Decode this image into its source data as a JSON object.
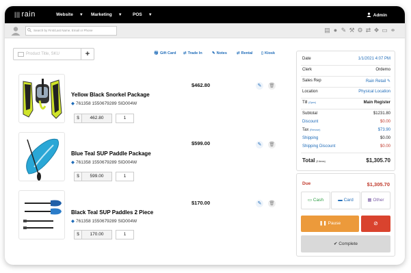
{
  "topbar": {
    "logo": "rain",
    "nav": [
      "Website",
      "Marketing",
      "POS"
    ],
    "user": "Admin"
  },
  "search": {
    "placeholder": "Search by First/Last Name, Email or Phone"
  },
  "toolbar_icons": [
    "document-icon",
    "chat-icon",
    "edit-icon",
    "wrench-icon",
    "gear-icon",
    "exchange-icon",
    "dropbox-icon",
    "card-icon",
    "handshake-icon"
  ],
  "product_search": {
    "placeholder": "Product Title, SKU"
  },
  "actions": {
    "gift_card": "Gift Card",
    "trade_in": "Trade In",
    "notes": "Notes",
    "rental": "Rental",
    "kiosk": "Kiosk"
  },
  "items": [
    {
      "name": "Yellow Black Snorkel Package",
      "sku": "761358 1550679289 SID004W",
      "price": "$462.80",
      "unit_price": "462.80",
      "qty": "1"
    },
    {
      "name": "Blue Teal  SUP Paddle Package",
      "sku": "761358 1550679289 SID004W",
      "price": "$599.00",
      "unit_price": "599.00",
      "qty": "1"
    },
    {
      "name": "Black Teal  SUP Paddles 2 Piece",
      "sku": "761358 1550679289 SID004W",
      "price": "$170.00",
      "unit_price": "170.00",
      "qty": "1"
    }
  ],
  "summary": {
    "date_label": "Date",
    "date_value": "1/1/2021 4:07 PM",
    "clerk_label": "Clerk",
    "clerk_value": "Ordemo",
    "sales_rep_label": "Sales Rep",
    "sales_rep_value": "Rain Retail",
    "location_label": "Location",
    "location_value": "Physical Location",
    "till_label": "Till",
    "till_open": "(Open)",
    "till_value": "Main Register",
    "subtotal_label": "Subtotal",
    "subtotal_value": "$1231.80",
    "discount_label": "Discount",
    "discount_value": "$0.00",
    "tax_label": "Tax",
    "tax_remove": "(Remove)",
    "tax_value": "$73.90",
    "shipping_label": "Shipping",
    "shipping_value": "$0.00",
    "shipping_discount_label": "Shipping Discount",
    "shipping_discount_value": "$0.00",
    "total_label": "Total",
    "total_items": "(3 items)",
    "total_value": "$1,305.70"
  },
  "payment": {
    "due_label": "Due",
    "due_value": "$1,305.70",
    "cash": "Cash",
    "card": "Card",
    "other": "Other",
    "pause": "Pause",
    "complete": "Complete"
  },
  "colors": {
    "accent": "#1e6bb8",
    "pause": "#ec9a3b",
    "cancel": "#d9432e",
    "due": "#c0392b"
  }
}
